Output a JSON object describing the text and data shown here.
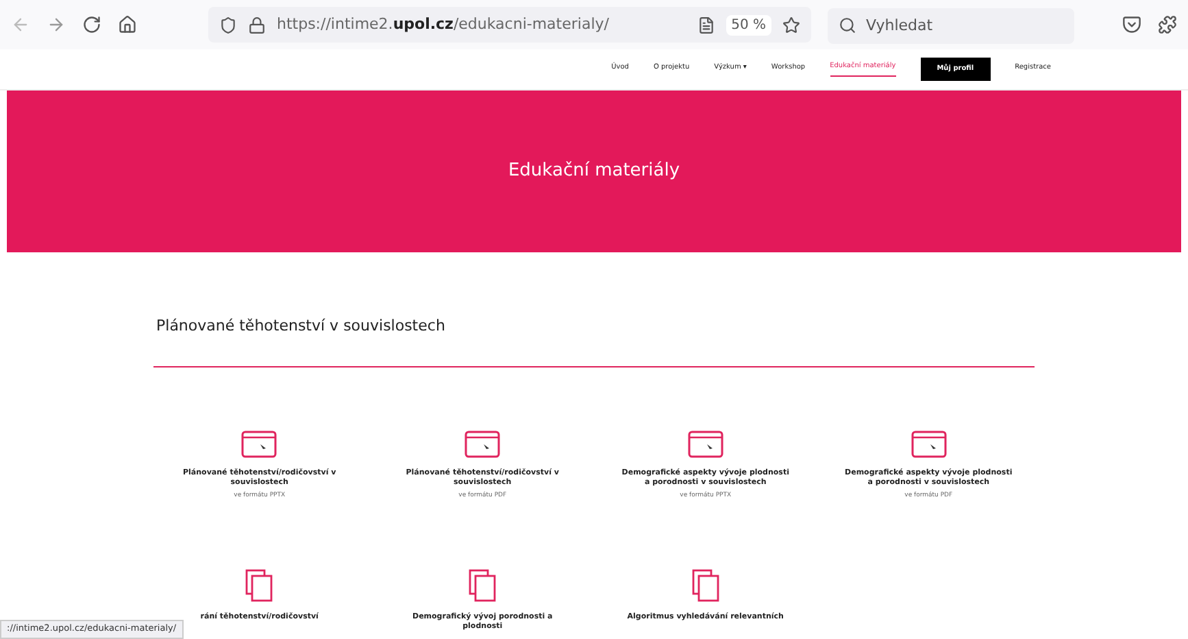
{
  "browser": {
    "url_prefix": "https://intime2.",
    "url_domain": "upol.cz",
    "url_path": "/edukacni-materialy/",
    "zoom": "50 %",
    "search_placeholder": "Vyhledat"
  },
  "nav": [
    {
      "label": "Úvod",
      "selected": false,
      "kind": "link"
    },
    {
      "label": "O projektu",
      "selected": false,
      "kind": "link"
    },
    {
      "label": "Výzkum ▾",
      "selected": false,
      "kind": "link"
    },
    {
      "label": "Workshop",
      "selected": false,
      "kind": "link"
    },
    {
      "label": "Edukační materiály",
      "selected": true,
      "kind": "link"
    },
    {
      "label": "Můj profil",
      "selected": false,
      "kind": "button"
    },
    {
      "label": "Registrace",
      "selected": false,
      "kind": "link"
    }
  ],
  "hero": {
    "title": "Edukační materiály"
  },
  "section": {
    "title": "Plánované těhotenství v souvislostech"
  },
  "materials": [
    {
      "kind": "window",
      "title": "Plánované těhotenství/rodičovství v souvislostech",
      "format": "ve formátu PPTX"
    },
    {
      "kind": "window",
      "title": "Plánované těhotenství/rodičovství v souvislostech",
      "format": "ve formátu PDF"
    },
    {
      "kind": "window",
      "title": "Demografické aspekty vývoje plodnosti a porodnosti v souvislostech",
      "format": "ve formátu PPTX"
    },
    {
      "kind": "window",
      "title": "Demografické aspekty vývoje plodnosti a porodnosti v souvislostech",
      "format": "ve formátu PDF"
    },
    {
      "kind": "copy",
      "title": "rání těhotenství/rodičovství"
    },
    {
      "kind": "copy",
      "title": "Demografický vývoj porodnosti a plodnosti"
    },
    {
      "kind": "copy",
      "title": "Algoritmus vyhledávání relevantních"
    }
  ],
  "status_bar": {
    "url": "://intime2.upol.cz/edukacni-materialy/"
  }
}
